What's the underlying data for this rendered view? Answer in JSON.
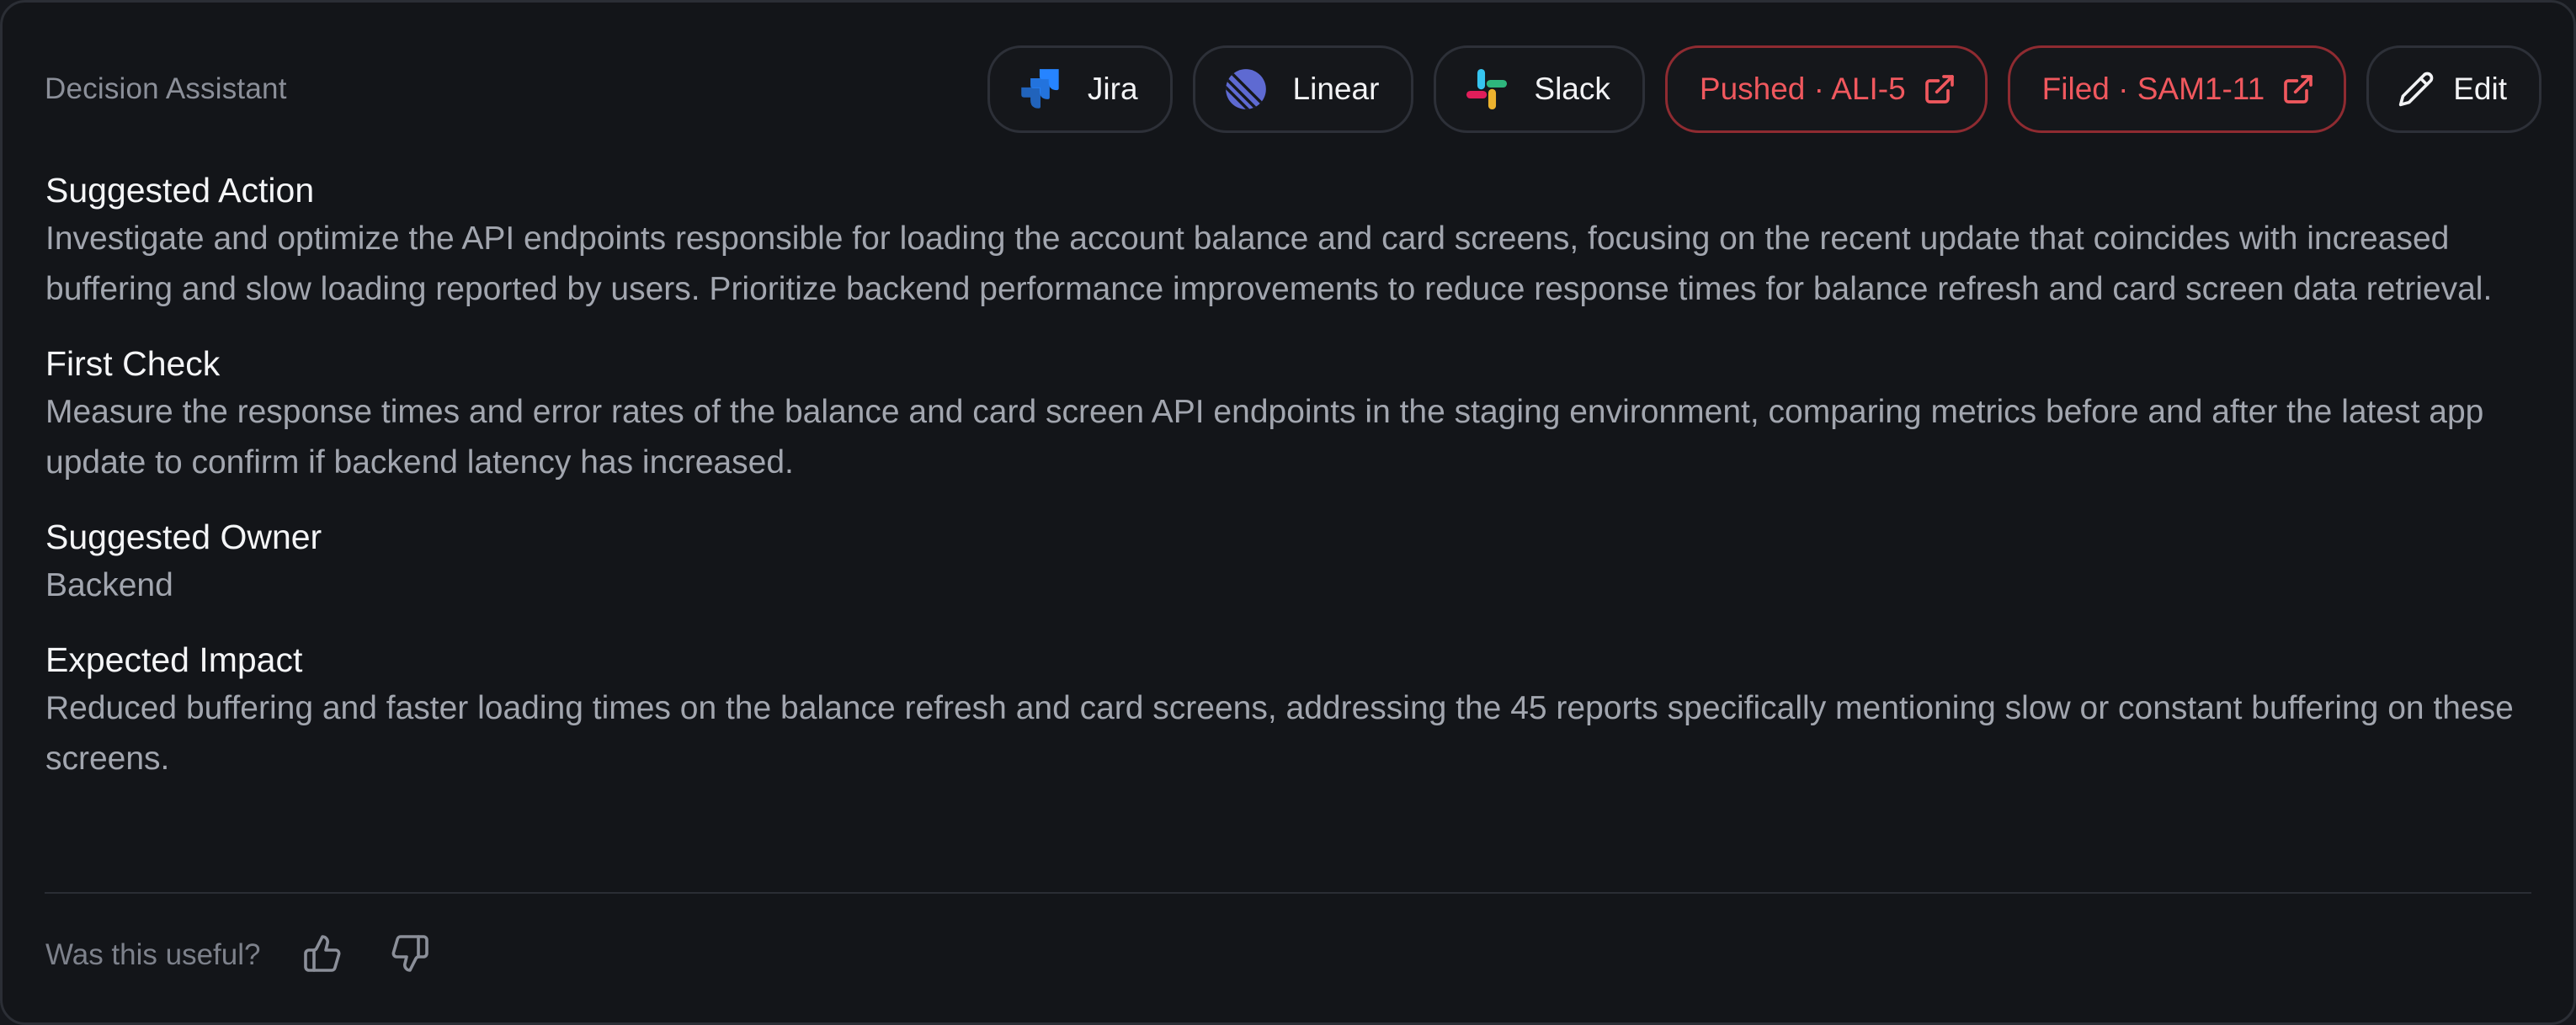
{
  "header": {
    "title": "Decision Assistant"
  },
  "integrations": [
    {
      "label": "Jira",
      "icon": "jira-icon"
    },
    {
      "label": "Linear",
      "icon": "linear-icon"
    },
    {
      "label": "Slack",
      "icon": "slack-icon"
    }
  ],
  "status_links": [
    {
      "label": "Pushed · ALI-5",
      "icon": "external-link-icon"
    },
    {
      "label": "Filed · SAM1-11",
      "icon": "external-link-icon"
    }
  ],
  "edit": {
    "label": "Edit",
    "icon": "pencil-icon"
  },
  "sections": [
    {
      "title": "Suggested Action",
      "body": "Investigate and optimize the API endpoints responsible for loading the account balance and card screens, focusing on the recent update that coincides with increased buffering and slow loading reported by users. Prioritize backend performance improvements to reduce response times for balance refresh and card screen data retrieval."
    },
    {
      "title": "First Check",
      "body": "Measure the response times and error rates of the balance and card screen API endpoints in the staging environment, comparing metrics before and after the latest app update to confirm if backend latency has increased."
    },
    {
      "title": "Suggested Owner",
      "body": "Backend"
    },
    {
      "title": "Expected Impact",
      "body": "Reduced buffering and faster loading times on the balance refresh and card screens, addressing the 45 reports specifically mentioning slow or constant buffering on these screens."
    }
  ],
  "feedback": {
    "question": "Was this useful?",
    "up_icon": "thumbs-up-icon",
    "down_icon": "thumbs-down-icon"
  },
  "colors": {
    "background": "#131519",
    "accent_red": "#f0585e",
    "jira_blue": "#2684ff",
    "linear_purple": "#5e6ad2"
  }
}
